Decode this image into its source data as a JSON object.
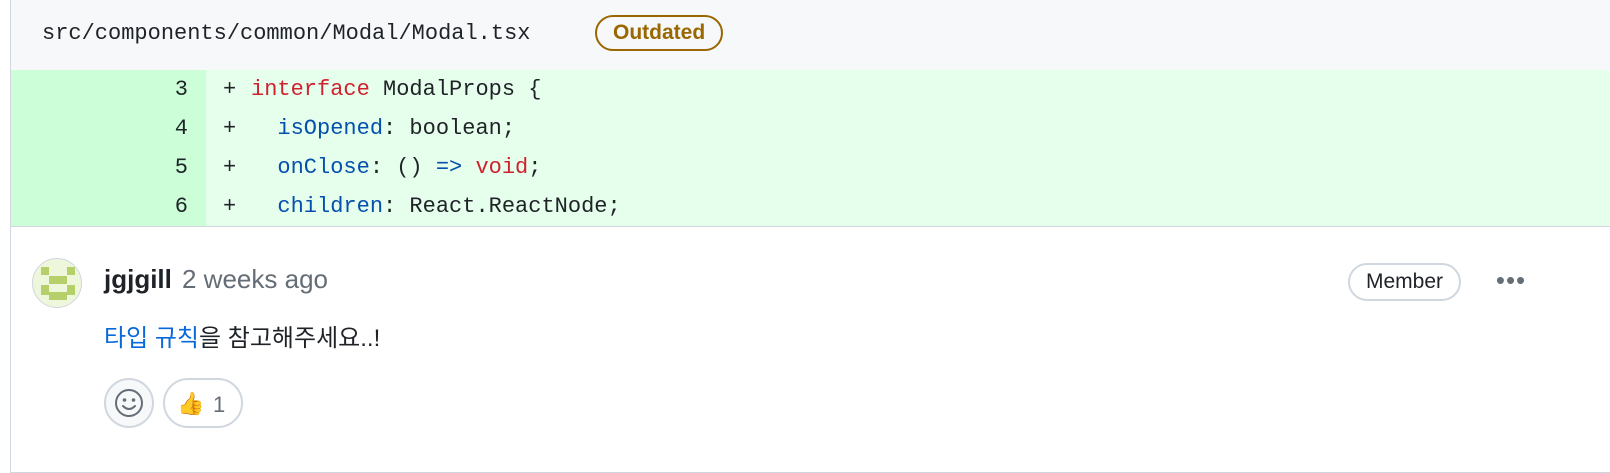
{
  "file": {
    "path": "src/components/common/Modal/Modal.tsx",
    "status_badge": "Outdated"
  },
  "diff_lines": [
    {
      "number": "3",
      "marker": "+",
      "tokens": [
        "interface",
        " ModalProps {"
      ]
    },
    {
      "number": "4",
      "marker": "+",
      "tokens": [
        "  ",
        "isOpened",
        ": boolean;"
      ]
    },
    {
      "number": "5",
      "marker": "+",
      "tokens": [
        "  ",
        "onClose",
        ": () ",
        "=>",
        " ",
        "void",
        ";"
      ]
    },
    {
      "number": "6",
      "marker": "+",
      "tokens": [
        "  ",
        "children",
        ": React.ReactNode;"
      ]
    }
  ],
  "comment": {
    "author": "jgjgill",
    "time": "2 weeks ago",
    "role_badge": "Member",
    "more_label": "•••",
    "link_text": "타입 규칙",
    "body_text": "을 참고해주세요..!",
    "reactions": [
      {
        "emoji": "👍",
        "count": "1"
      }
    ]
  },
  "colors": {
    "added_line_bg": "#e6ffec",
    "added_number_bg": "#ccffd8",
    "keyword": "#cf222e",
    "identifier": "#0550ae",
    "link": "#0969da",
    "outdated": "#9a6700"
  },
  "icons": {
    "avatar": "identicon-avatar",
    "add_reaction": "smiley-icon",
    "more": "kebab-horizontal-icon"
  }
}
